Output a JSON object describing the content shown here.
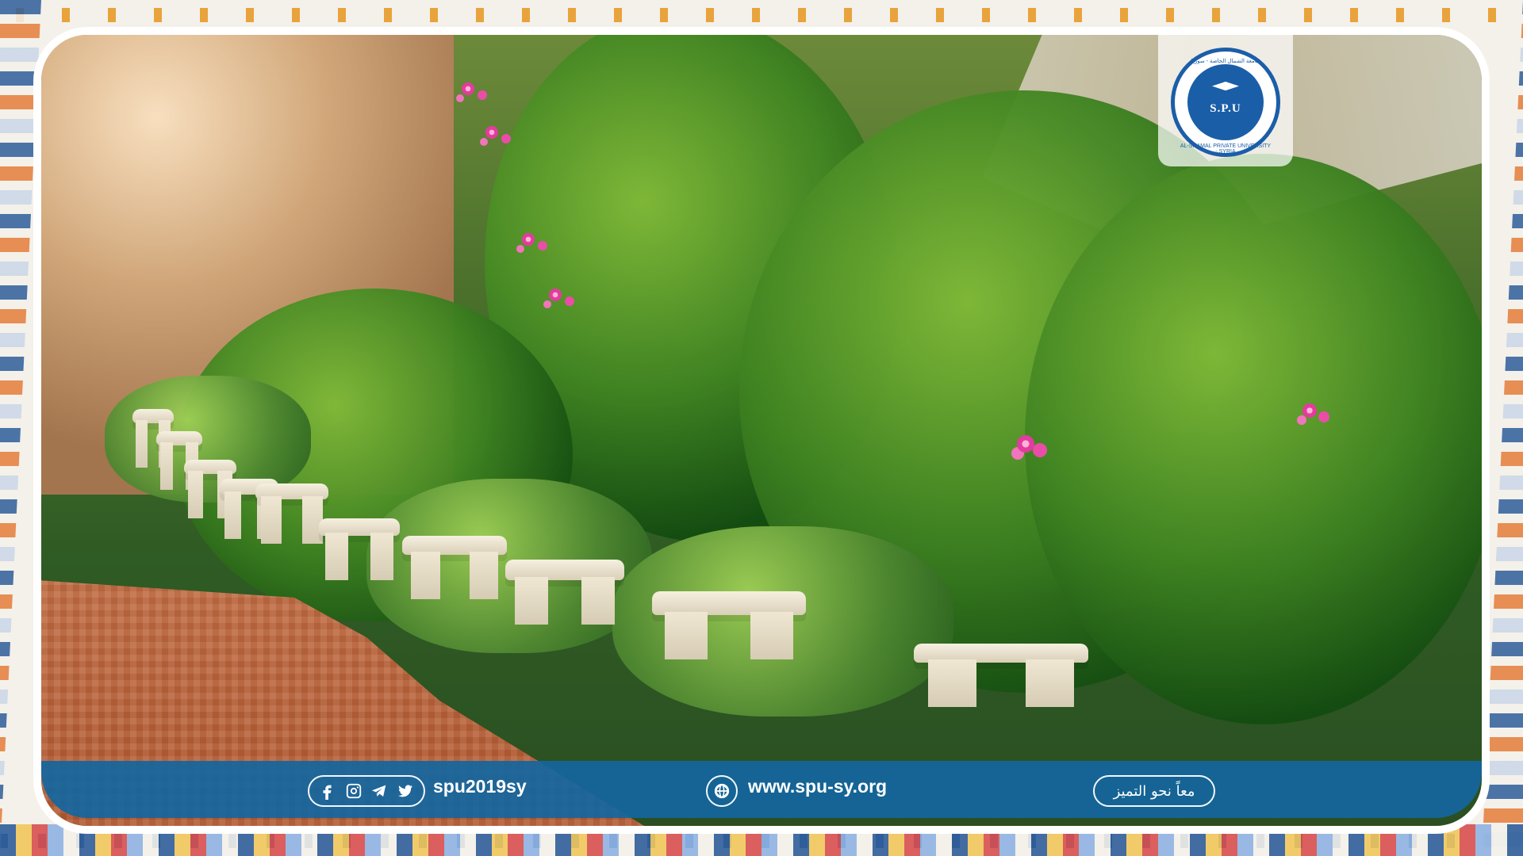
{
  "brand": {
    "logo_abbreviation": "S.P.U",
    "logo_arabic_text": "جامعة الشمال الخاصة - سوريا",
    "logo_english_text": "AL-SHAMAL PRIVATE UNIVERSITY - SYRIA",
    "primary_color": "#1b5ea8",
    "footer_color": "#1466a0"
  },
  "footer": {
    "social_handle": "spu2019sy",
    "website": "www.spu-sy.org",
    "motto": "معاً نحو التميز",
    "icons": [
      "facebook-icon",
      "instagram-icon",
      "telegram-icon",
      "twitter-icon",
      "globe-icon"
    ]
  }
}
